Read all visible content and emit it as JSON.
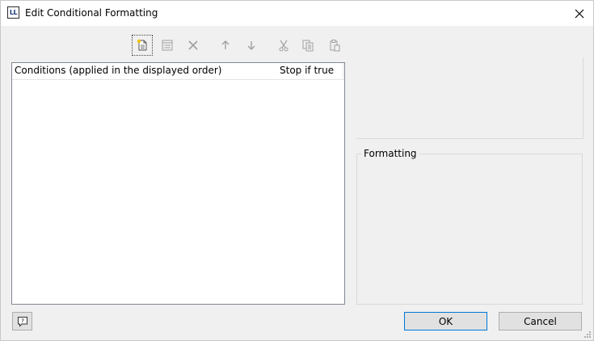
{
  "window": {
    "title": "Edit Conditional Formatting",
    "app_icon_text": "LL"
  },
  "toolbar": {
    "buttons": [
      {
        "icon": "new-condition-icon",
        "enabled": true,
        "focused": true
      },
      {
        "icon": "edit-condition-icon",
        "enabled": false
      },
      {
        "icon": "delete-icon",
        "enabled": false
      },
      {
        "icon": "arrow-up-icon",
        "enabled": false
      },
      {
        "icon": "arrow-down-icon",
        "enabled": false
      },
      {
        "icon": "cut-icon",
        "enabled": false
      },
      {
        "icon": "copy-icon",
        "enabled": false
      },
      {
        "icon": "paste-icon",
        "enabled": false
      }
    ]
  },
  "conditions_list": {
    "columns": [
      "Conditions (applied in the displayed order)",
      "Stop if true"
    ],
    "rows": []
  },
  "formatting": {
    "label": "Formatting"
  },
  "buttons": {
    "ok": "OK",
    "cancel": "Cancel",
    "help_icon": "help-icon"
  },
  "colors": {
    "background": "#f0f0f0",
    "titlebar": "#ffffff",
    "disabled_icon": "#a0a0a0",
    "focus_border": "#0078d7"
  }
}
